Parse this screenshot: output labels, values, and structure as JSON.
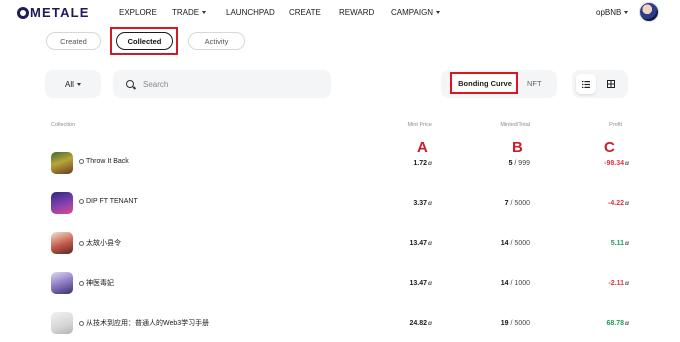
{
  "colors": {
    "annotation": "#d01b24",
    "negative": "#e0323f",
    "positive": "#1e9e58",
    "logo": "#1e1a5c"
  },
  "brand": {
    "logo_text": "METALE"
  },
  "nav": {
    "items": [
      {
        "label": "EXPLORE",
        "caret": false
      },
      {
        "label": "TRADE",
        "caret": true
      },
      {
        "label": "LAUNCHPAD",
        "caret": false
      },
      {
        "label": "CREATE",
        "caret": false
      },
      {
        "label": "REWARD",
        "caret": false
      },
      {
        "label": "CAMPAIGN",
        "caret": true
      }
    ],
    "network": "opBNB"
  },
  "tabs": [
    {
      "label": "Created",
      "active": false
    },
    {
      "label": "Collected",
      "active": true
    },
    {
      "label": "Activity",
      "active": false
    }
  ],
  "filters": {
    "all_label": "All",
    "search_placeholder": "Search",
    "toggle": {
      "bonding_curve": "Bonding Curve",
      "nft": "NFT",
      "selected": "Bonding Curve"
    },
    "views": {
      "list_icon": "list-icon",
      "grid_icon": "grid-icon",
      "selected": "list"
    }
  },
  "table": {
    "headers": {
      "collection": "Collection",
      "mint_price": "Mint Price",
      "minted_total": "Minted/Total",
      "profit": "Profit"
    },
    "annotations": {
      "a": "A",
      "b": "B",
      "c": "C"
    },
    "unit_symbol": "ɑ",
    "rows": [
      {
        "name": "Throw It Back",
        "mint_price": "1.72",
        "minted": "5",
        "total": "/ 999",
        "profit": "-98.34",
        "profit_sign": "negative"
      },
      {
        "name": "DIP FT TENANT",
        "mint_price": "3.37",
        "minted": "7",
        "total": "/ 5000",
        "profit": "-4.22",
        "profit_sign": "negative"
      },
      {
        "name": "太故小县令",
        "mint_price": "13.47",
        "minted": "14",
        "total": "/ 5000",
        "profit": "5.11",
        "profit_sign": "positive"
      },
      {
        "name": "神医毒妃",
        "mint_price": "13.47",
        "minted": "14",
        "total": "/ 1000",
        "profit": "-2.11",
        "profit_sign": "negative"
      },
      {
        "name": "从技术到应用：普通人的Web3学习手册",
        "mint_price": "24.82",
        "minted": "19",
        "total": "/ 5000",
        "profit": "68.78",
        "profit_sign": "positive"
      }
    ]
  }
}
